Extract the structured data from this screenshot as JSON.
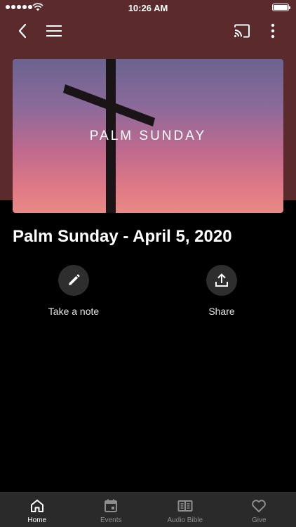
{
  "status_bar": {
    "time": "10:26 AM",
    "battery_level": 1.0
  },
  "toolbar": {
    "back_icon": "chevron-left-icon",
    "menu_icon": "hamburger-menu-icon",
    "cast_icon": "cast-icon",
    "more_icon": "more-vertical-icon"
  },
  "hero": {
    "text": "PALM SUNDAY"
  },
  "page": {
    "title": "Palm Sunday - April 5, 2020"
  },
  "actions": [
    {
      "label": "Take a note",
      "icon": "pencil-icon"
    },
    {
      "label": "Share",
      "icon": "share-upload-icon"
    }
  ],
  "tabs": [
    {
      "label": "Home",
      "icon": "home-icon",
      "active": true
    },
    {
      "label": "Events",
      "icon": "calendar-icon",
      "active": false
    },
    {
      "label": "Audio Bible",
      "icon": "book-icon",
      "active": false
    },
    {
      "label": "Give",
      "icon": "heart-icon",
      "active": false
    }
  ],
  "colors": {
    "header_bg": "#5a2a2c",
    "background": "#000000",
    "tab_bar": "#2a2a2a"
  }
}
